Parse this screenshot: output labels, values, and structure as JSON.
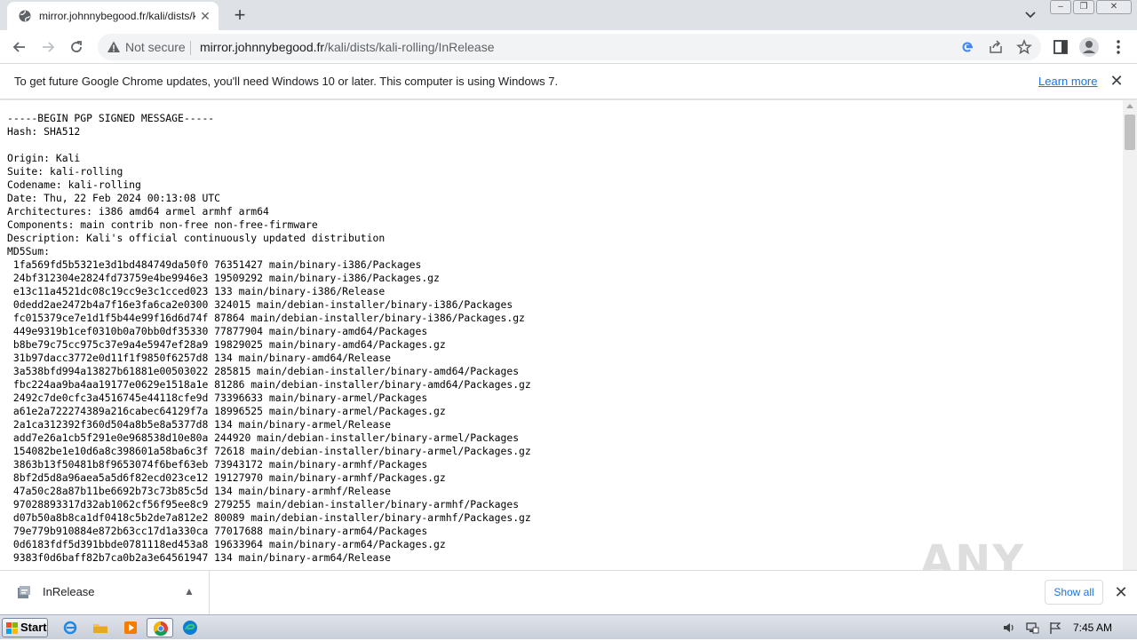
{
  "browser": {
    "tab": {
      "title": "mirror.johnnybegood.fr/kali/dists/kali-rolling/InRelease",
      "favicon": "globe-icon"
    },
    "omnibox": {
      "security_label": "Not secure",
      "url_host": "mirror.johnnybegood.fr",
      "url_path": "/kali/dists/kali-rolling/InRelease"
    },
    "infobar": {
      "message": "To get future Google Chrome updates, you'll need Windows 10 or later. This computer is using Windows 7.",
      "link": "Learn more"
    }
  },
  "document_lines": [
    "-----BEGIN PGP SIGNED MESSAGE-----",
    "Hash: SHA512",
    "",
    "Origin: Kali",
    "Suite: kali-rolling",
    "Codename: kali-rolling",
    "Date: Thu, 22 Feb 2024 00:13:08 UTC",
    "Architectures: i386 amd64 armel armhf arm64",
    "Components: main contrib non-free non-free-firmware",
    "Description: Kali's official continuously updated distribution",
    "MD5Sum:",
    " 1fa569fd5b5321e3d1bd484749da50f0 76351427 main/binary-i386/Packages",
    " 24bf312304e2824fd73759e4be9946e3 19509292 main/binary-i386/Packages.gz",
    " e13c11a4521dc08c19cc9e3c1cced023 133 main/binary-i386/Release",
    " 0dedd2ae2472b4a7f16e3fa6ca2e0300 324015 main/debian-installer/binary-i386/Packages",
    " fc015379ce7e1d1f5b44e99f16d6d74f 87864 main/debian-installer/binary-i386/Packages.gz",
    " 449e9319b1cef0310b0a70bb0df35330 77877904 main/binary-amd64/Packages",
    " b8be79c75cc975c37e9a4e5947ef28a9 19829025 main/binary-amd64/Packages.gz",
    " 31b97dacc3772e0d11f1f9850f6257d8 134 main/binary-amd64/Release",
    " 3a538bfd994a13827b61881e00503022 285815 main/debian-installer/binary-amd64/Packages",
    " fbc224aa9ba4aa19177e0629e1518a1e 81286 main/debian-installer/binary-amd64/Packages.gz",
    " 2492c7de0cfc3a4516745e44118cfe9d 73396633 main/binary-armel/Packages",
    " a61e2a722274389a216cabec64129f7a 18996525 main/binary-armel/Packages.gz",
    " 2a1ca312392f360d504a8b5e8a5377d8 134 main/binary-armel/Release",
    " add7e26a1cb5f291e0e968538d10e80a 244920 main/debian-installer/binary-armel/Packages",
    " 154082be1e10d6a8c398601a58ba6c3f 72618 main/debian-installer/binary-armel/Packages.gz",
    " 3863b13f50481b8f9653074f6bef63eb 73943172 main/binary-armhf/Packages",
    " 8bf2d5d8a96aea5a5d6f82ecd023ce12 19127970 main/binary-armhf/Packages.gz",
    " 47a50c28a87b11be6692b73c73b85c5d 134 main/binary-armhf/Release",
    " 97028893317d32ab1062cf56f95ee8c9 279255 main/debian-installer/binary-armhf/Packages",
    " d07b50a8b8ca1df0418c5b2de7a812e2 80089 main/debian-installer/binary-armhf/Packages.gz",
    " 79e779b910884e872b63cc17d1a330ca 77017688 main/binary-arm64/Packages",
    " 0d6183fdf5d391bbde0781118ed453a8 19633964 main/binary-arm64/Packages.gz",
    " 9383f0d6baff82b7ca0b2a3e64561947 134 main/binary-arm64/Release"
  ],
  "download_shelf": {
    "item_name": "InRelease",
    "show_all": "Show all"
  },
  "watermark": "ANY RUN",
  "taskbar": {
    "start_label": "Start",
    "clock": "7:45 AM"
  },
  "colors": {
    "tabstrip": "#dee1e6",
    "link": "#1a73e8",
    "text": "#000000"
  }
}
